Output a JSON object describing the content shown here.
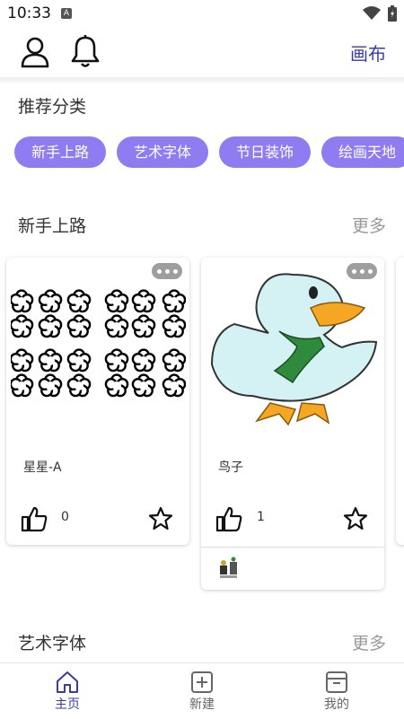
{
  "status": {
    "time": "10:33",
    "notif_glyph": "A"
  },
  "header": {
    "canvas_label": "画布",
    "icons": [
      "user-icon",
      "bell-icon"
    ]
  },
  "recommend": {
    "title": "推荐分类",
    "chips": [
      "新手上路",
      "艺术字体",
      "节日装饰",
      "绘画天地"
    ],
    "chip_color": "#8e7cf0"
  },
  "section1": {
    "title": "新手上路",
    "more": "更多",
    "cards": [
      {
        "title": "星星-A",
        "likes": "0"
      },
      {
        "title": "鸟子",
        "likes": "1"
      }
    ]
  },
  "section2": {
    "title": "艺术字体",
    "more": "更多"
  },
  "nav": {
    "items": [
      {
        "label": "主页",
        "icon": "home-icon",
        "active": true
      },
      {
        "label": "新建",
        "icon": "plus-box-icon",
        "active": false
      },
      {
        "label": "我的",
        "icon": "box-icon",
        "active": false
      }
    ],
    "active_color": "#3b3aa8",
    "inactive_color": "#666666"
  }
}
